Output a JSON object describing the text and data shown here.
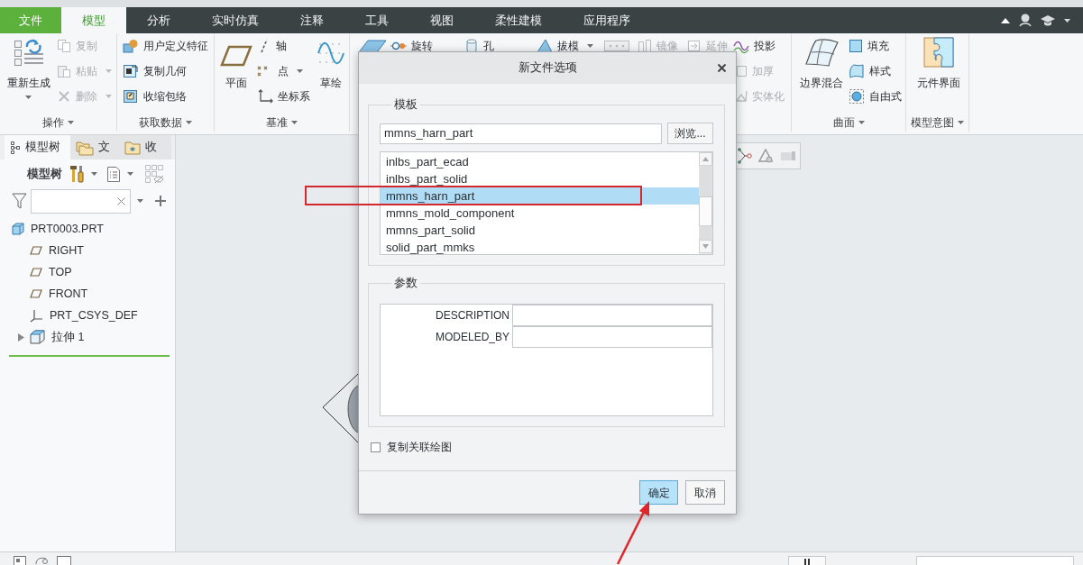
{
  "ribbon_tabs": [
    {
      "label": "文件",
      "kind": "file",
      "selected": false
    },
    {
      "label": "模型",
      "kind": "tab",
      "selected": true
    },
    {
      "label": "分析",
      "kind": "tab",
      "selected": false
    },
    {
      "label": "实时仿真",
      "kind": "tab",
      "selected": false
    },
    {
      "label": "注释",
      "kind": "tab",
      "selected": false
    },
    {
      "label": "工具",
      "kind": "tab",
      "selected": false
    },
    {
      "label": "视图",
      "kind": "tab",
      "selected": false
    },
    {
      "label": "柔性建模",
      "kind": "tab",
      "selected": false
    },
    {
      "label": "应用程序",
      "kind": "tab",
      "selected": false
    }
  ],
  "ribbon_groups": [
    {
      "label": "操作",
      "columns": [
        [
          {
            "kind": "large",
            "label": "重新生成",
            "dropdown": true,
            "disabled": false
          }
        ],
        [
          {
            "kind": "small",
            "label": "复制",
            "dropdown": false,
            "disabled": true
          },
          {
            "kind": "small",
            "label": "粘贴",
            "dropdown": true,
            "disabled": true
          },
          {
            "kind": "small",
            "label": "删除",
            "dropdown": true,
            "disabled": true
          }
        ]
      ]
    },
    {
      "label": "获取数据",
      "columns": [
        [
          {
            "kind": "small",
            "label": "用户定义特征",
            "dropdown": false,
            "disabled": false
          },
          {
            "kind": "small",
            "label": "复制几何",
            "dropdown": false,
            "disabled": false
          },
          {
            "kind": "small",
            "label": "收缩包络",
            "dropdown": false,
            "disabled": false
          }
        ]
      ]
    },
    {
      "label": "基准",
      "columns": [
        [
          {
            "kind": "large",
            "label": "平面",
            "dropdown": false,
            "disabled": false
          }
        ],
        [
          {
            "kind": "small",
            "label": "轴",
            "dropdown": false,
            "disabled": false
          },
          {
            "kind": "small",
            "label": "点",
            "dropdown": true,
            "disabled": false
          },
          {
            "kind": "small",
            "label": "坐标系",
            "dropdown": false,
            "disabled": false
          }
        ],
        [
          {
            "kind": "large",
            "label": "草绘",
            "dropdown": false,
            "disabled": false
          }
        ]
      ]
    },
    {
      "columns": [
        [
          {
            "kind": "icon",
            "dropdown": false,
            "disabled": false
          }
        ],
        [
          {
            "kind": "small",
            "label": "旋转",
            "dropdown": false,
            "disabled": false
          }
        ],
        [
          {
            "kind": "small",
            "label": "孔",
            "dropdown": false,
            "disabled": false
          }
        ],
        [
          {
            "kind": "small",
            "label": "拔模",
            "dropdown": true,
            "disabled": false
          }
        ],
        [
          {
            "kind": "icon",
            "dropdown": false,
            "disabled": true
          }
        ],
        [
          {
            "kind": "small",
            "label": "镜像",
            "dropdown": false,
            "disabled": true
          }
        ],
        [
          {
            "kind": "small",
            "label": "延伸",
            "dropdown": false,
            "disabled": true
          }
        ],
        [
          {
            "kind": "small",
            "label": "投影",
            "dropdown": false,
            "disabled": false
          },
          {
            "kind": "small",
            "label": "加厚",
            "dropdown": false,
            "disabled": true
          },
          {
            "kind": "small",
            "label": "实体化",
            "dropdown": false,
            "disabled": true
          }
        ]
      ]
    },
    {
      "label": "曲面",
      "columns": [
        [
          {
            "kind": "large",
            "label": "边界混合",
            "dropdown": false,
            "disabled": false
          }
        ],
        [
          {
            "kind": "small",
            "label": "填充",
            "dropdown": false,
            "disabled": false
          },
          {
            "kind": "small",
            "label": "样式",
            "dropdown": false,
            "disabled": false
          },
          {
            "kind": "small",
            "label": "自由式",
            "dropdown": false,
            "disabled": false
          }
        ]
      ]
    },
    {
      "label": "模型意图",
      "columns": [
        [
          {
            "kind": "large",
            "label": "元件界面",
            "dropdown": false,
            "disabled": false
          }
        ]
      ]
    }
  ],
  "model_tree_panel": {
    "tabs": [
      {
        "label": "模型树",
        "selected": true
      },
      {
        "label": "文",
        "selected": false
      },
      {
        "label": "收",
        "selected": false
      }
    ],
    "toolbar_label": "模型树",
    "tree": [
      {
        "label": "PRT0003.PRT",
        "kind": "part",
        "children": [
          {
            "label": "RIGHT",
            "kind": "plane"
          },
          {
            "label": "TOP",
            "kind": "plane"
          },
          {
            "label": "FRONT",
            "kind": "plane"
          },
          {
            "label": "PRT_CSYS_DEF",
            "kind": "csys"
          },
          {
            "label": "拉伸 1",
            "kind": "feature",
            "expanded": false
          }
        ]
      }
    ]
  },
  "dialog": {
    "title": "新文件选项",
    "template_group": {
      "label": "模板",
      "value": "mmns_harn_part",
      "browse_button": "浏览...",
      "list": [
        {
          "label": "inlbs_part_ecad",
          "selected": false
        },
        {
          "label": "inlbs_part_solid",
          "selected": false
        },
        {
          "label": "mmns_harn_part",
          "selected": true
        },
        {
          "label": "mmns_mold_component",
          "selected": false
        },
        {
          "label": "mmns_part_solid",
          "selected": false
        },
        {
          "label": "solid_part_mmks",
          "selected": false
        }
      ]
    },
    "parameters_group": {
      "label": "参数",
      "rows": [
        {
          "name": "DESCRIPTION"
        },
        {
          "name": "MODELED_BY"
        }
      ]
    },
    "copy_drawing": {
      "label": "复制关联绘图",
      "checked": false
    },
    "buttons": [
      {
        "label": "确定",
        "kind": "primary"
      },
      {
        "label": "取消",
        "kind": "secondary"
      }
    ]
  }
}
